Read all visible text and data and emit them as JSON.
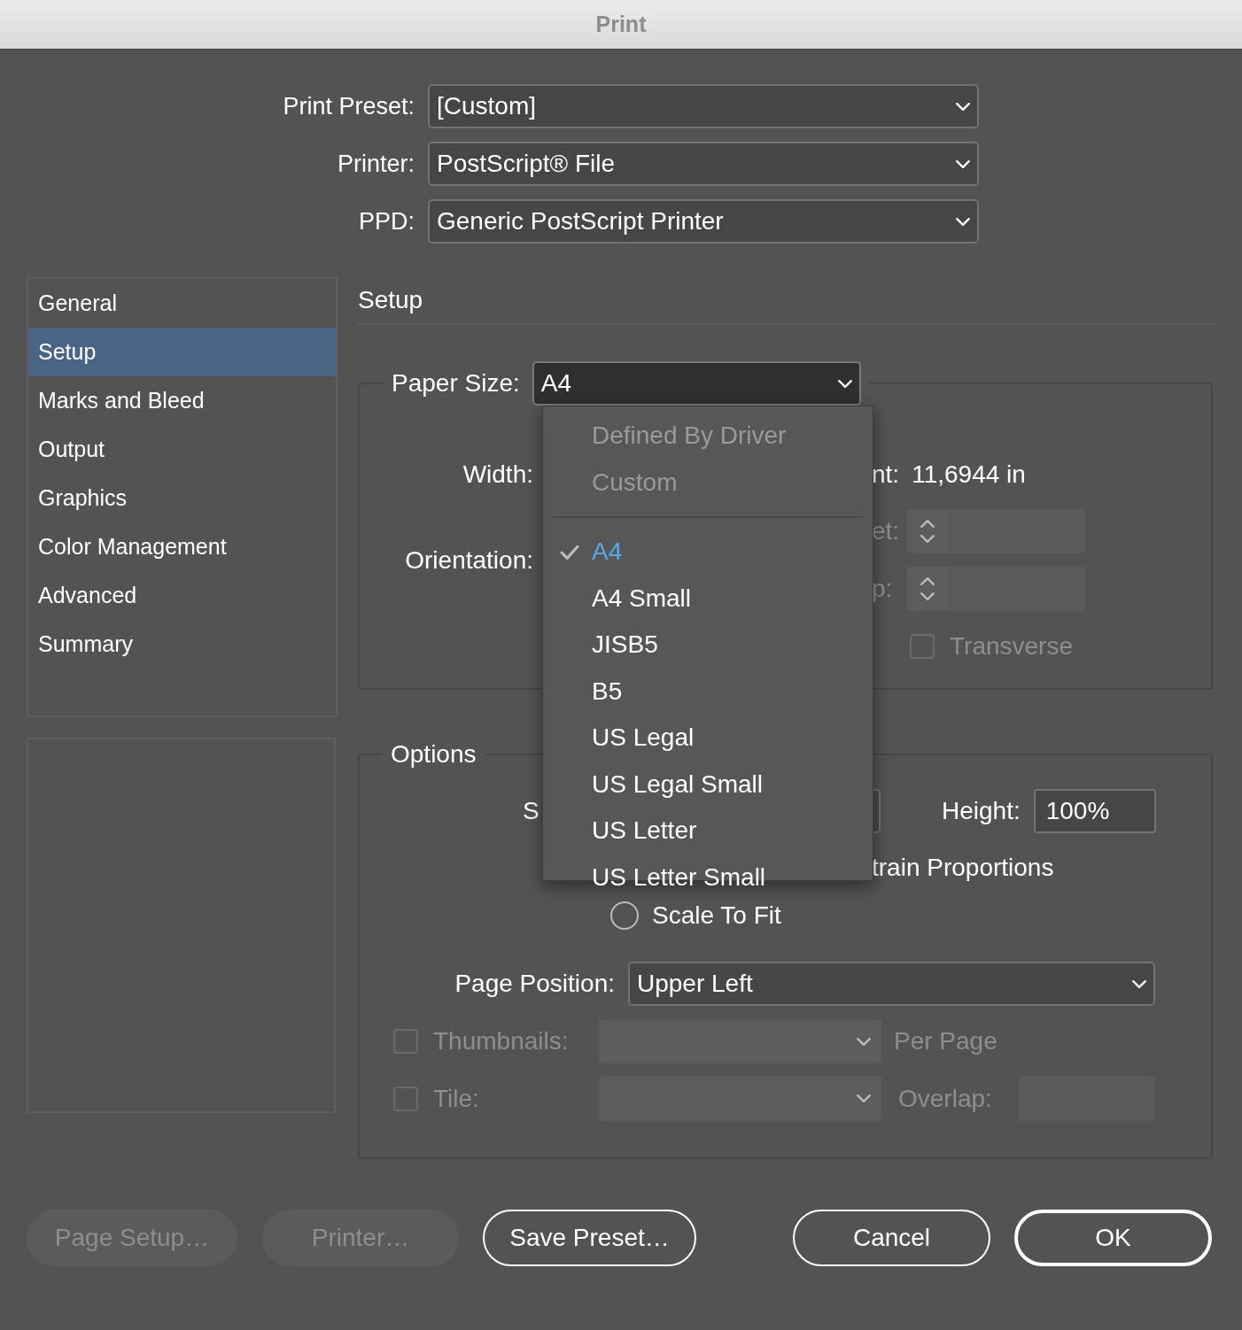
{
  "window": {
    "title": "Print"
  },
  "top_fields": [
    {
      "label": "Print Preset:",
      "value": "[Custom]"
    },
    {
      "label": "Printer:",
      "value": "PostScript® File"
    },
    {
      "label": "PPD:",
      "value": "Generic PostScript Printer"
    }
  ],
  "sidebar": {
    "items": [
      {
        "label": "General",
        "selected": false
      },
      {
        "label": "Setup",
        "selected": true
      },
      {
        "label": "Marks and Bleed",
        "selected": false
      },
      {
        "label": "Output",
        "selected": false
      },
      {
        "label": "Graphics",
        "selected": false
      },
      {
        "label": "Color Management",
        "selected": false
      },
      {
        "label": "Advanced",
        "selected": false
      },
      {
        "label": "Summary",
        "selected": false
      }
    ]
  },
  "section_title": "Setup",
  "paper_size": {
    "label": "Paper Size:",
    "value": "A4",
    "menu": [
      {
        "kind": "item",
        "label": "Defined By Driver",
        "disabled": true,
        "checked": false
      },
      {
        "kind": "item",
        "label": "Custom",
        "disabled": true,
        "checked": false
      },
      {
        "kind": "separator"
      },
      {
        "kind": "item",
        "label": "A4",
        "disabled": false,
        "checked": true
      },
      {
        "kind": "item",
        "label": "A4 Small",
        "disabled": false,
        "checked": false
      },
      {
        "kind": "item",
        "label": "JISB5",
        "disabled": false,
        "checked": false
      },
      {
        "kind": "item",
        "label": "B5",
        "disabled": false,
        "checked": false
      },
      {
        "kind": "item",
        "label": "US Legal",
        "disabled": false,
        "checked": false
      },
      {
        "kind": "item",
        "label": "US Legal Small",
        "disabled": false,
        "checked": false
      },
      {
        "kind": "item",
        "label": "US Letter",
        "disabled": false,
        "checked": false
      },
      {
        "kind": "item",
        "label": "US Letter Small",
        "disabled": false,
        "checked": false
      }
    ]
  },
  "paper_group": {
    "width_label": "Width:",
    "height_fragment": "nt:",
    "height_value": "11,6944 in",
    "orientation_label": "Orientation:",
    "offset_fragment": "et:",
    "gap_fragment": "p:",
    "transverse": {
      "label": "Transverse",
      "checked": false,
      "disabled": true
    }
  },
  "options": {
    "title": "Options",
    "scale_fragment": "S",
    "height_label": "Height:",
    "height_value": "100%",
    "constrain_fragment": "train Proportions",
    "scale_to_fit": {
      "label": "Scale To Fit",
      "selected": false
    },
    "page_position": {
      "label": "Page Position:",
      "value": "Upper Left"
    },
    "thumbnails": {
      "label": "Thumbnails:",
      "checked": false,
      "disabled": true,
      "suffix": "Per Page"
    },
    "tile": {
      "label": "Tile:",
      "checked": false,
      "disabled": true,
      "overlap_label": "Overlap:"
    }
  },
  "buttons": [
    {
      "label": "Page Setup…",
      "kind": "normal",
      "disabled": true
    },
    {
      "label": "Printer…",
      "kind": "normal",
      "disabled": true
    },
    {
      "label": "Save Preset…",
      "kind": "normal",
      "disabled": false
    },
    {
      "label": "Cancel",
      "kind": "normal",
      "disabled": false
    },
    {
      "label": "OK",
      "kind": "default",
      "disabled": false
    }
  ]
}
